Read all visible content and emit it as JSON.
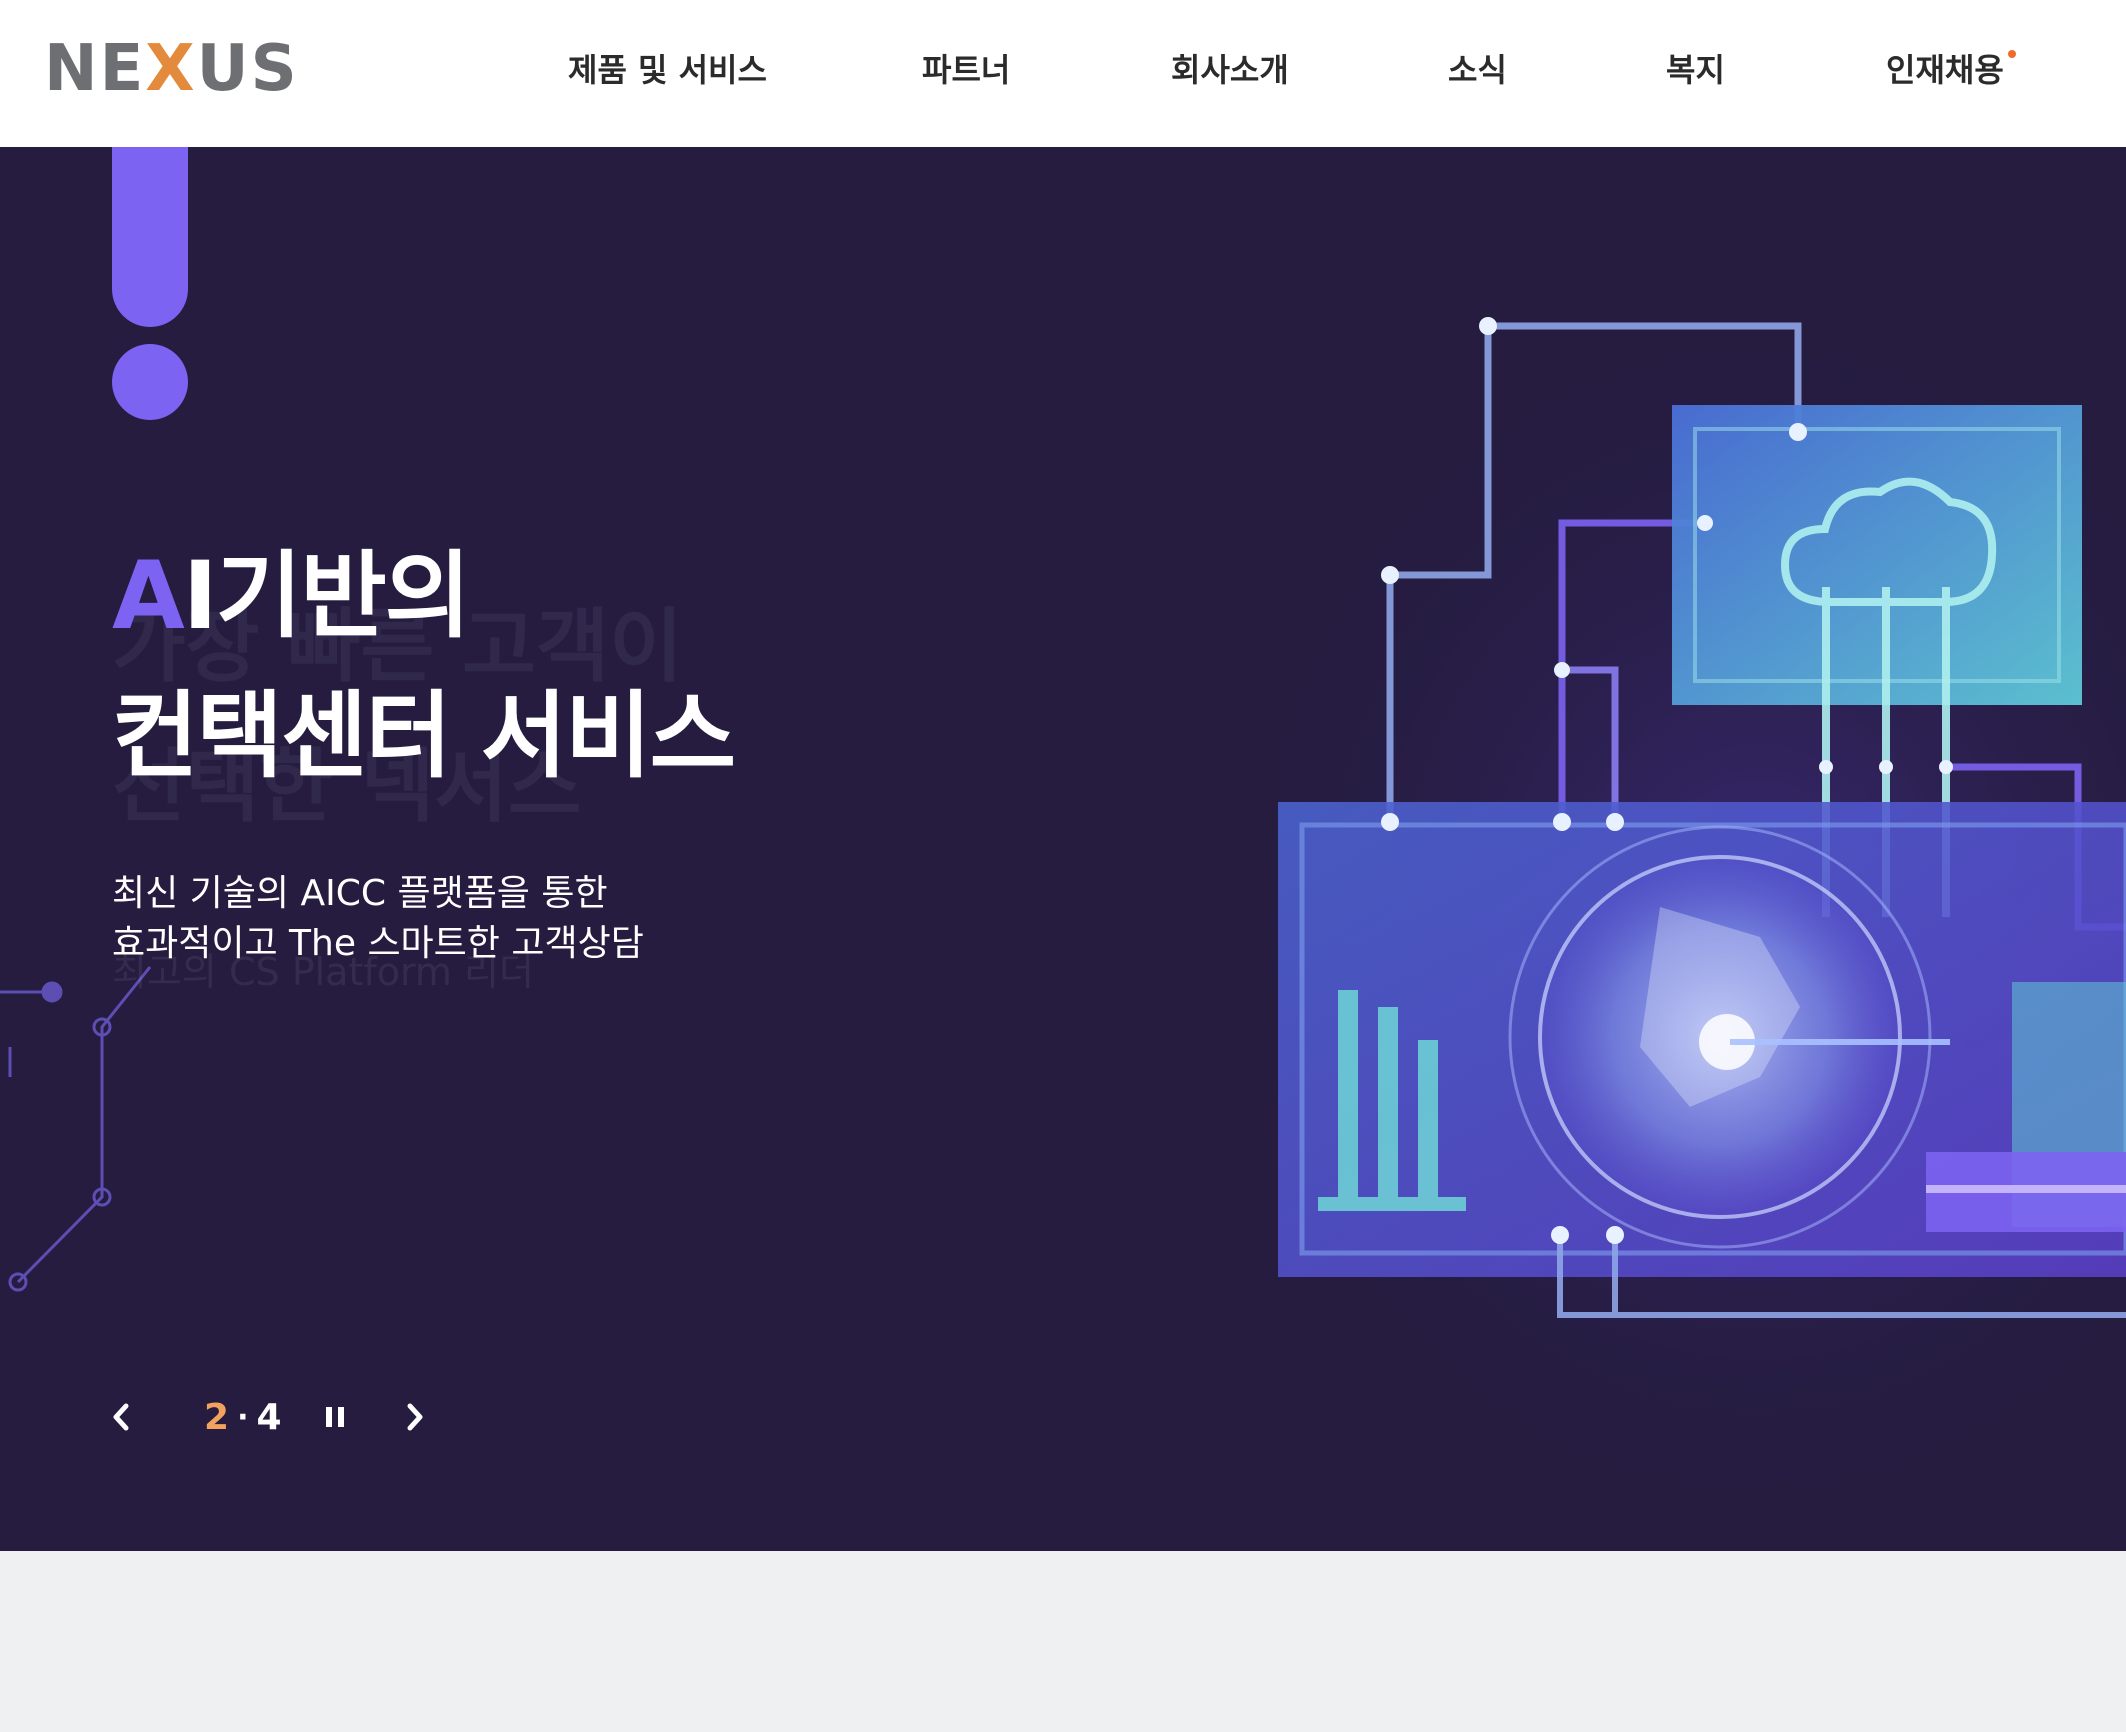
{
  "header": {
    "logo": {
      "part1": "NE",
      "part2": "X",
      "part3": "US"
    },
    "nav": [
      {
        "label": "제품 및 서비스"
      },
      {
        "label": "파트너"
      },
      {
        "label": "회사소개"
      },
      {
        "label": "소식"
      },
      {
        "label": "복지"
      },
      {
        "label": "인재채용"
      }
    ]
  },
  "hero": {
    "title_accent": "A",
    "title_line1_rest": "I기반의",
    "title_line2": "컨택센터 서비스",
    "ghost_line1": "가장 빠른 고객이",
    "ghost_line2": "선택한 넥서스",
    "subtitle_line1": "최신 기술의 AICC 플랫폼을 통한",
    "subtitle_line2": "효과적이고 The 스마트한 고객상담",
    "ghost_subtitle": "최고의 CS Platform 리더",
    "slider": {
      "current": "2",
      "separator": "·",
      "total": "4"
    },
    "colors": {
      "accent": "#7c63f1",
      "counter": "#f2a15e",
      "background": "#251c40"
    }
  },
  "icons": {
    "prev": "chevron-left-icon",
    "pause": "pause-icon",
    "next": "chevron-right-icon",
    "cloud": "cloud-icon",
    "globe": "globe-icon"
  }
}
